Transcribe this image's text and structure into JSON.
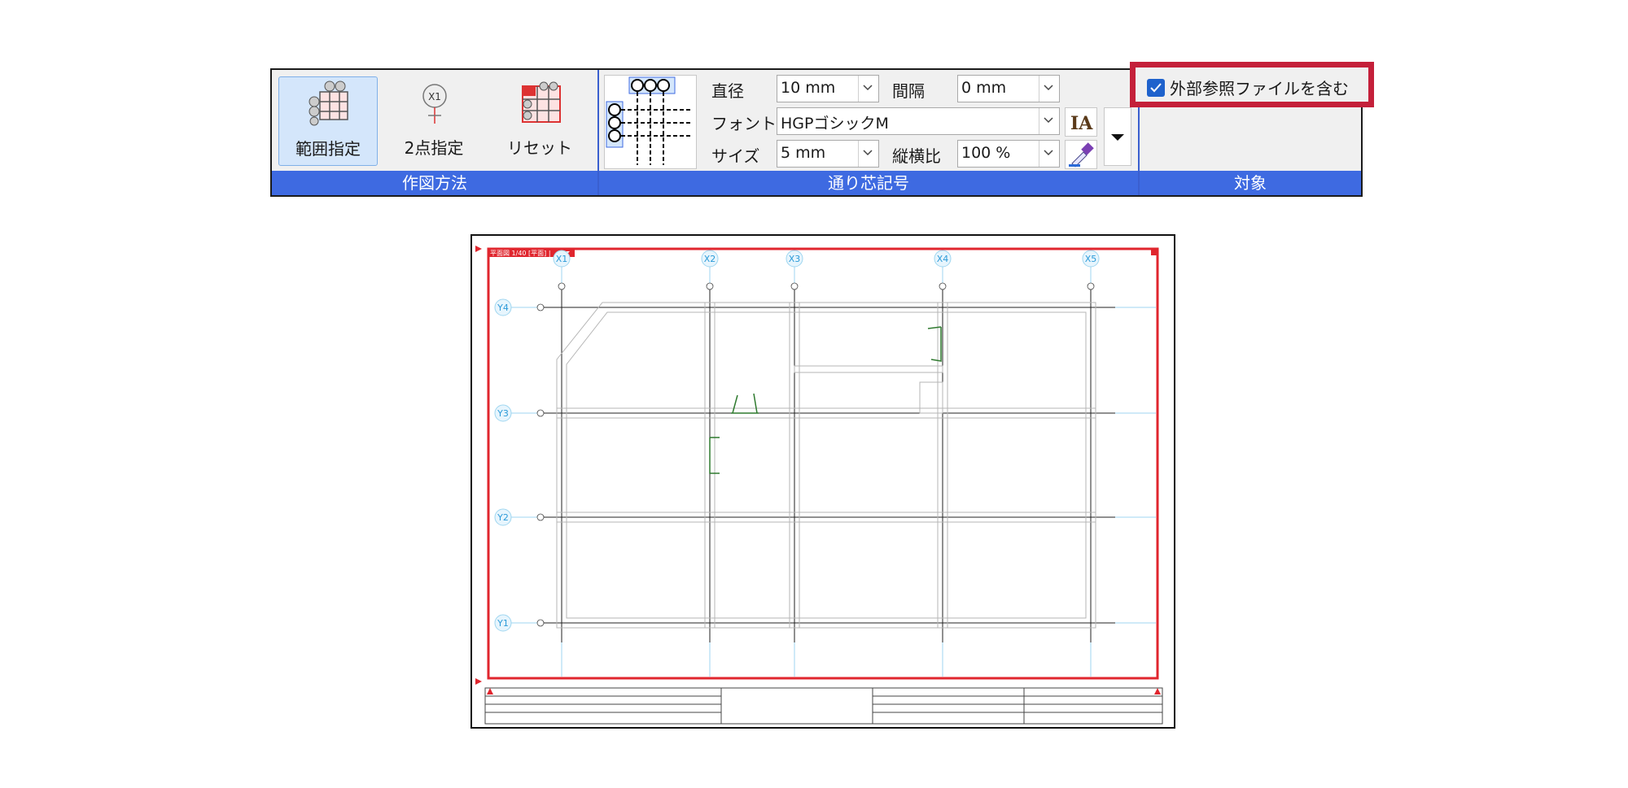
{
  "ribbon": {
    "groups": {
      "method": "作図方法",
      "symbol": "通り芯記号",
      "target": "対象"
    },
    "method_buttons": {
      "range": "範囲指定",
      "two_point": "2点指定",
      "reset": "リセット"
    },
    "symbol_fields": {
      "diameter_label": "直径",
      "diameter_value": "10 mm",
      "spacing_label": "間隔",
      "spacing_value": "0 mm",
      "font_label": "フォント",
      "font_value": "HGPゴシックM",
      "size_label": "サイズ",
      "size_value": "5 mm",
      "aspect_label": "縦横比",
      "aspect_value": "100 %"
    },
    "target": {
      "checkbox_label": "外部参照ファイルを含む",
      "checked": true
    }
  },
  "drawing": {
    "tab_label": "平面図 1/40 [平面] |",
    "x_axes": [
      "X1",
      "X2",
      "X3",
      "X4",
      "X5"
    ],
    "y_axes": [
      "Y4",
      "Y3",
      "Y2",
      "Y1"
    ]
  },
  "colors": {
    "accent_blue": "#3e6ae1",
    "highlight_red": "#c4203a",
    "frame_red": "#e0262e",
    "axis_cyan": "#2b9ad8"
  }
}
